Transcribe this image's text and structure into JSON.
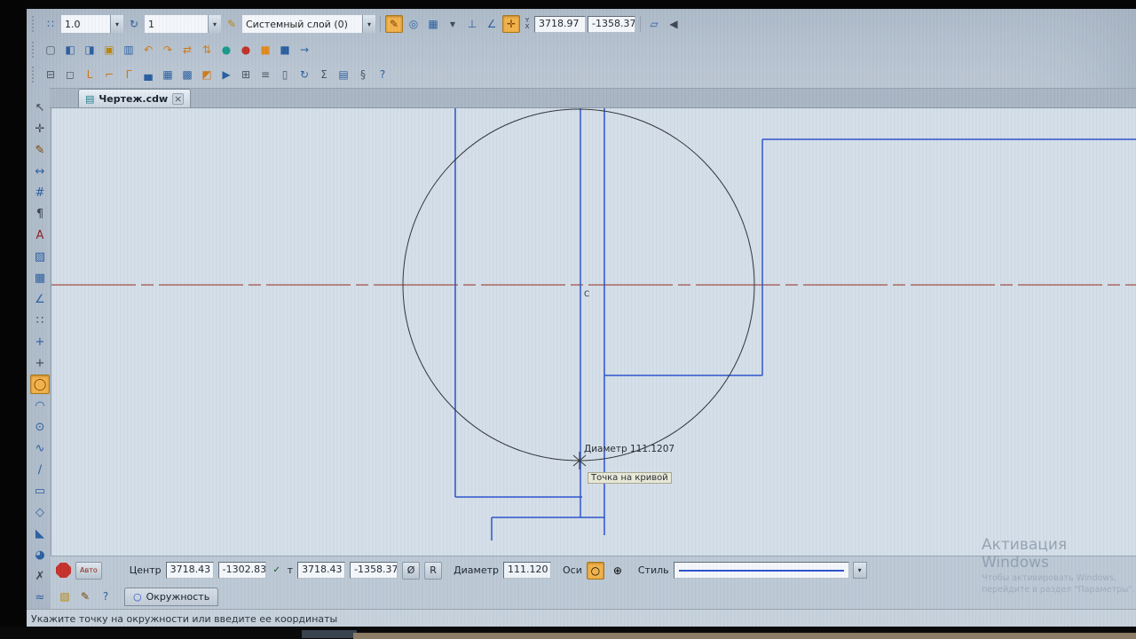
{
  "window": {
    "tab_title": "Чертеж.cdw",
    "status_message": "Укажите точку на окружности или введите ее координаты"
  },
  "icons": {
    "caret": "▾",
    "close": "×",
    "check": "✓",
    "doc": "▤",
    "axes_plain": "○",
    "axes_cross": "⊕",
    "process_circle": "○",
    "y_label": "Y",
    "x_label": "X"
  },
  "toolbar_top": {
    "zoom_value": "1.0",
    "layer_number": "1",
    "layer_name": "Системный слой (0)",
    "coord_x": "3718.97",
    "coord_y": "-1358.37"
  },
  "toolbars": {
    "row1_a": [
      {
        "name": "current-state-icon",
        "glyph": "∷",
        "fg": "#2a5fa0"
      }
    ],
    "row1_b": [
      {
        "name": "zoom-refresh-icon",
        "glyph": "↻",
        "fg": "#2a5fa0"
      }
    ],
    "row1_c": [
      {
        "name": "layer-edit-icon",
        "glyph": "✎",
        "fg": "#b8860b"
      }
    ],
    "row1_d": [
      {
        "name": "draw-mode-icon",
        "glyph": "✎",
        "fg": "#7a3f00",
        "active": true
      },
      {
        "name": "zoom-area-icon",
        "glyph": "◎",
        "fg": "#2a5fa0"
      },
      {
        "name": "grid-icon",
        "glyph": "▦",
        "fg": "#2a5fa0"
      },
      {
        "name": "grid-caret-icon",
        "glyph": "▾",
        "fg": "#3c4650"
      },
      {
        "name": "ortho-icon",
        "glyph": "⊥",
        "fg": "#2a5fa0"
      },
      {
        "name": "local-csys-icon",
        "glyph": "∠",
        "fg": "#2a5fa0"
      },
      {
        "name": "snap-toggle-icon",
        "glyph": "✛",
        "fg": "#7a3f00",
        "active": true
      }
    ],
    "row1_e": [
      {
        "name": "copy-properties-icon",
        "glyph": "▱",
        "fg": "#2a5fa0"
      },
      {
        "name": "speaker-icon",
        "glyph": "◀",
        "fg": "#3c4650"
      }
    ],
    "row2": [
      {
        "name": "new-sheet-icon",
        "glyph": "▢",
        "fg": "#4a5663"
      },
      {
        "name": "window-layout-icon",
        "glyph": "◧",
        "fg": "#2a5fa0"
      },
      {
        "name": "window-layout-alt-icon",
        "glyph": "◨",
        "fg": "#2a5fa0"
      },
      {
        "name": "open-folder-icon",
        "glyph": "▣",
        "fg": "#b8860b"
      },
      {
        "name": "save-icon",
        "glyph": "▥",
        "fg": "#2a5fa0"
      },
      {
        "name": "rotate-left-icon",
        "glyph": "↶",
        "fg": "#d07818"
      },
      {
        "name": "rotate-right-icon",
        "glyph": "↷",
        "fg": "#d07818"
      },
      {
        "name": "move-icon",
        "glyph": "⇄",
        "fg": "#d07818"
      },
      {
        "name": "shift-icon",
        "glyph": "⇅",
        "fg": "#d07818"
      },
      {
        "name": "sphere-icon",
        "glyph": "●",
        "fg": "#1a9a8a"
      },
      {
        "name": "stop-mark-icon",
        "glyph": "●",
        "fg": "#c03028"
      },
      {
        "name": "orange-box-icon",
        "glyph": "■",
        "fg": "#e08a20"
      },
      {
        "name": "blue-box-icon",
        "glyph": "■",
        "fg": "#2a5fa0"
      },
      {
        "name": "pointer-arrow-icon",
        "glyph": "→",
        "fg": "#2a5fa0"
      }
    ],
    "row3": [
      {
        "name": "print-icon",
        "glyph": "⊟",
        "fg": "#4a5663"
      },
      {
        "name": "preview-icon",
        "glyph": "◻",
        "fg": "#4a5663"
      },
      {
        "name": "ruler-icon",
        "glyph": "L",
        "fg": "#d07818"
      },
      {
        "name": "ruler-flip-icon",
        "glyph": "⌐",
        "fg": "#d07818"
      },
      {
        "name": "corner-icon",
        "glyph": "Γ",
        "fg": "#d07818"
      },
      {
        "name": "stamp-icon",
        "glyph": "▄",
        "fg": "#2a5fa0"
      },
      {
        "name": "table-icon",
        "glyph": "▦",
        "fg": "#2a5fa0"
      },
      {
        "name": "fill-icon",
        "glyph": "▩",
        "fg": "#2a5fa0"
      },
      {
        "name": "palette-icon",
        "glyph": "◩",
        "fg": "#d07818"
      },
      {
        "name": "run-icon",
        "glyph": "▶",
        "fg": "#2a5fa0"
      },
      {
        "name": "grid-page-icon",
        "glyph": "⊞",
        "fg": "#4a5663"
      },
      {
        "name": "tree-list-icon",
        "glyph": "≡",
        "fg": "#4a5663"
      },
      {
        "name": "doc-blank-icon",
        "glyph": "▯",
        "fg": "#4a5663"
      },
      {
        "name": "refresh-icon",
        "glyph": "↻",
        "fg": "#2a5fa0"
      },
      {
        "name": "sum-icon",
        "glyph": "Σ",
        "fg": "#4a5663"
      },
      {
        "name": "spreadsheet-icon",
        "glyph": "▤",
        "fg": "#2a5fa0"
      },
      {
        "name": "info-icon",
        "glyph": "§",
        "fg": "#4a5663"
      },
      {
        "name": "help-icon",
        "glyph": "?",
        "fg": "#2a5fa0"
      }
    ],
    "palette": [
      {
        "name": "select-tool",
        "glyph": "↖",
        "fg": "#3c4650"
      },
      {
        "name": "pan-tool",
        "glyph": "✛",
        "fg": "#3c4650"
      },
      {
        "name": "pencil-tool",
        "glyph": "✎",
        "fg": "#7a3f00"
      },
      {
        "name": "dimension-tool",
        "glyph": "↔",
        "fg": "#2a5fa0"
      },
      {
        "name": "hash-grid-tool",
        "glyph": "#",
        "fg": "#2a5fa0"
      },
      {
        "name": "designation-tool",
        "glyph": "¶",
        "fg": "#3c4650"
      },
      {
        "name": "text-tool",
        "glyph": "A",
        "fg": "#8a2020"
      },
      {
        "name": "hatch-tool",
        "glyph": "▨",
        "fg": "#2a5fa0"
      },
      {
        "name": "table-tool",
        "glyph": "▦",
        "fg": "#2a5fa0"
      },
      {
        "name": "angle-measure-tool",
        "glyph": "∠",
        "fg": "#2a5fa0"
      },
      {
        "name": "points-array-tool",
        "glyph": "∷",
        "fg": "#3c4650"
      },
      {
        "name": "axis-tool",
        "glyph": "+",
        "fg": "#2a5fa0"
      },
      {
        "name": "point-tool",
        "glyph": "+",
        "fg": "#3c4650"
      },
      {
        "name": "circle-tool",
        "glyph": "◯",
        "fg": "#7a3f00",
        "active": true
      },
      {
        "name": "arc-tool",
        "glyph": "◠",
        "fg": "#2a5fa0"
      },
      {
        "name": "ellipse-tool",
        "glyph": "⊙",
        "fg": "#2a5fa0"
      },
      {
        "name": "spline-tool",
        "glyph": "∿",
        "fg": "#2a5fa0"
      },
      {
        "name": "line-tool",
        "glyph": "∕",
        "fg": "#2a5fa0"
      },
      {
        "name": "rectangle-tool",
        "glyph": "▭",
        "fg": "#2a5fa0"
      },
      {
        "name": "polygon-tool",
        "glyph": "◇",
        "fg": "#2a5fa0"
      },
      {
        "name": "chamfer-tool",
        "glyph": "◣",
        "fg": "#2a5fa0"
      },
      {
        "name": "fillet-tool",
        "glyph": "◕",
        "fg": "#2a5fa0"
      },
      {
        "name": "trim-tool",
        "glyph": "✗",
        "fg": "#3c4650"
      },
      {
        "name": "offset-tool",
        "glyph": "≈",
        "fg": "#2a5fa0"
      }
    ],
    "panel_icons": [
      {
        "name": "geometry-panel-icon",
        "glyph": "▧",
        "fg": "#b8860b"
      },
      {
        "name": "edit-object-icon",
        "glyph": "✎",
        "fg": "#7a3f00"
      },
      {
        "name": "help-panel-icon",
        "glyph": "?",
        "fg": "#2a5fa0"
      }
    ]
  },
  "panel": {
    "auto_label": "Авто",
    "center_label": "Центр",
    "center_x": "3718.43",
    "center_y": "-1302.83",
    "point_label": "т",
    "point_x": "3718.43",
    "point_y": "-1358.37",
    "diameter_symbol": "Ø",
    "radius_symbol": "R",
    "diameter_label": "Диаметр",
    "diameter_value": "111.120",
    "axes_label": "Оси",
    "style_label": "Стиль"
  },
  "process_tab": {
    "label": "Окружность"
  },
  "canvas": {
    "hint_diameter": "Диаметр 111.1207",
    "hint_point": "Точка на кривой",
    "center_marker": "C"
  },
  "watermark": {
    "title": "Активация Windows",
    "line2": "Чтобы активировать Windows,",
    "line3": "перейдите в раздел \"Параметры\"."
  }
}
